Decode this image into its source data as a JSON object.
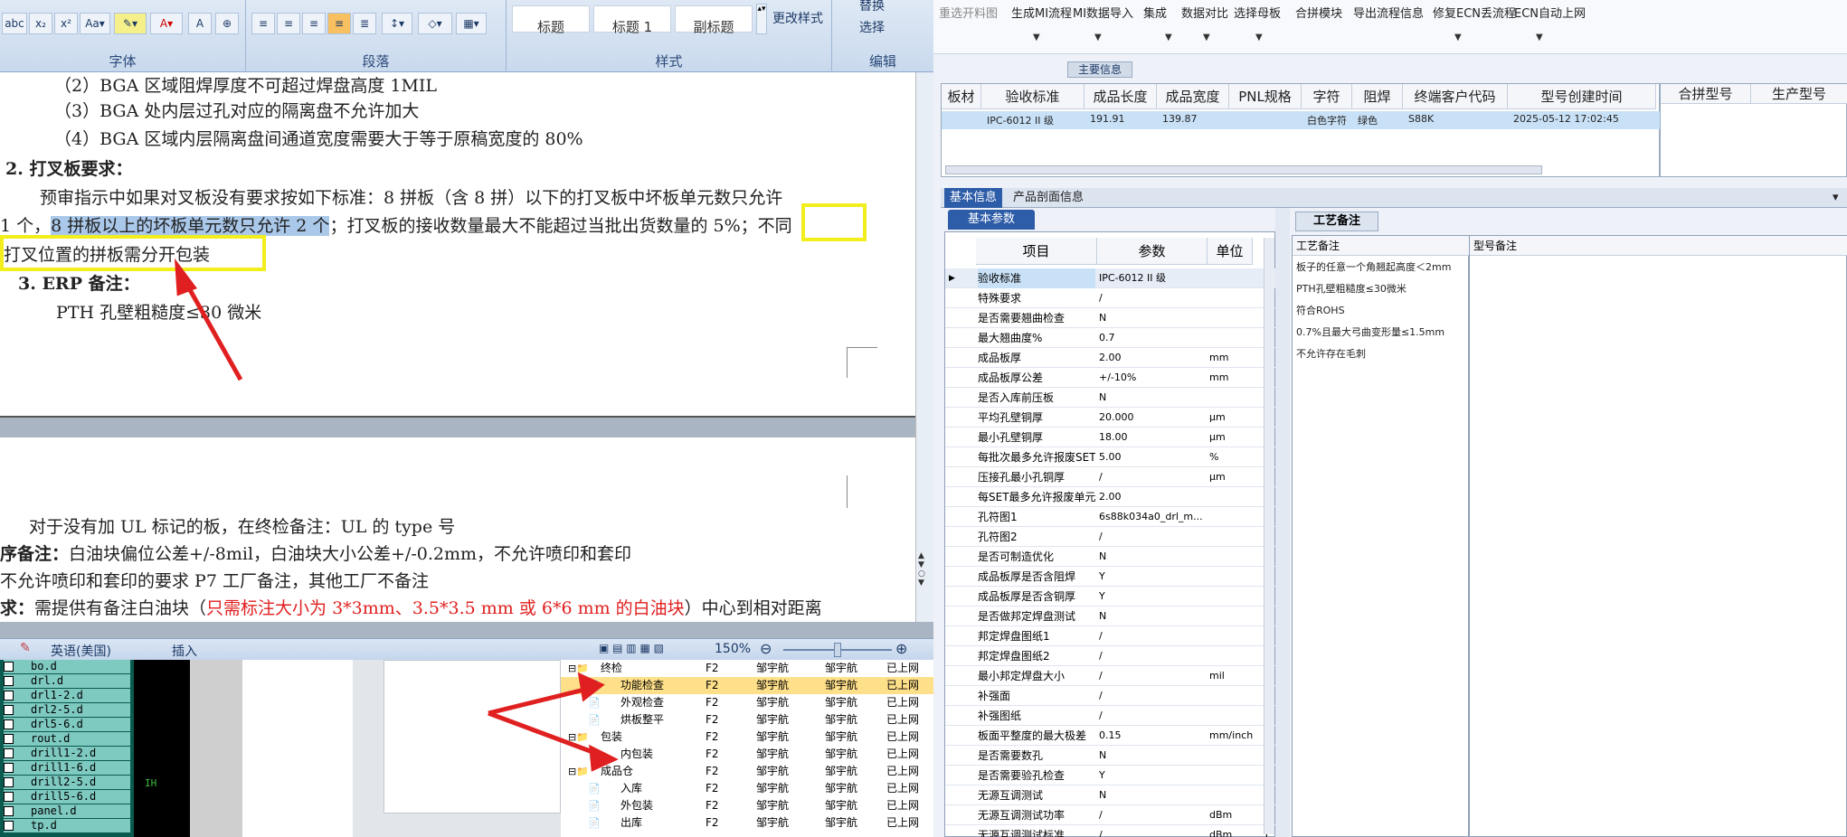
{
  "ribbon": {
    "group_font": "字体",
    "group_paragraph": "段落",
    "group_styles": "样式",
    "group_edit": "编辑",
    "styles": [
      "标题",
      "标题 1",
      "副标题"
    ],
    "change_styles": "更改样式",
    "replace": "替换",
    "select": "选择"
  },
  "doc": {
    "line1": "（2）BGA 区域阻焊厚度不可超过焊盘高度 1MIL",
    "line2": "（3）BGA 处内层过孔对应的隔离盘不允许加大",
    "line3": "（4）BGA 区域内层隔离盘间通道宽度需要大于等于原稿宽度的 80%",
    "line4": "2. 打叉板要求：",
    "line5": "预审指示中如果对叉板没有要求按如下标准：8 拼板（含 8 拼）以下的打叉板中坏板单元数只允许",
    "line6a": "1 个，",
    "line6b": "8 拼板以上的坏板单元数只允许 2 个",
    "line6c": "；打叉板的接收数量最大不能超过当批出货数量的 5%；",
    "line6d": "不同",
    "line7": "打叉位置的拼板需分开包装",
    "line8": "3. ERP 备注：",
    "line9": "PTH 孔壁粗糙度≤30 微米",
    "p2line1": "对于没有加 UL 标记的板，在终检备注：UL 的 type 号",
    "p2line2a": "序备注：",
    "p2line2b": "白油块偏位公差+/-8mil，白油块大小公差+/-0.2mm，不允许喷印和套印",
    "p2line3": "不允许喷印和套印的要求 P7 工厂备注，其他工厂不备注",
    "p2line4a": "求：",
    "p2line4b": "需提供有备注白油块（",
    "p2line4c": "只需标注大小为 3*3mm、3.5*3.5 mm 或 6*6 mm 的白油块",
    "p2line4d": "）中心到相对距离"
  },
  "status": {
    "language": "英语(美国)",
    "insert": "插入",
    "zoom": "150%"
  },
  "files": [
    "bo.d",
    "drl.d",
    "drl1-2.d",
    "drl2-5.d",
    "drl5-6.d",
    "rout.d",
    "drill1-2.d",
    "drill1-6.d",
    "drill2-5.d",
    "drill5-6.d",
    "panel.d",
    "tp.d"
  ],
  "greencon": {
    "label": "IH"
  },
  "tree": [
    {
      "indent": 0,
      "kind": "folder",
      "name": "终检",
      "c1": "F2",
      "c2": "邹宇航",
      "c3": "邹宇航",
      "c4": "已上网",
      "sel": false
    },
    {
      "indent": 1,
      "kind": "doc",
      "name": "功能检查",
      "c1": "F2",
      "c2": "邹宇航",
      "c3": "邹宇航",
      "c4": "已上网",
      "sel": true
    },
    {
      "indent": 1,
      "kind": "doc",
      "name": "外观检查",
      "c1": "F2",
      "c2": "邹宇航",
      "c3": "邹宇航",
      "c4": "已上网",
      "sel": false
    },
    {
      "indent": 1,
      "kind": "doc",
      "name": "烘板整平",
      "c1": "F2",
      "c2": "邹宇航",
      "c3": "邹宇航",
      "c4": "已上网",
      "sel": false
    },
    {
      "indent": 0,
      "kind": "folder",
      "name": "包装",
      "c1": "F2",
      "c2": "邹宇航",
      "c3": "邹宇航",
      "c4": "已上网",
      "sel": false
    },
    {
      "indent": 1,
      "kind": "doc",
      "name": "内包装",
      "c1": "F2",
      "c2": "邹宇航",
      "c3": "邹宇航",
      "c4": "已上网",
      "sel": false
    },
    {
      "indent": 0,
      "kind": "folder",
      "name": "成品仓",
      "c1": "F2",
      "c2": "邹宇航",
      "c3": "邹宇航",
      "c4": "已上网",
      "sel": false
    },
    {
      "indent": 1,
      "kind": "doc",
      "name": "入库",
      "c1": "F2",
      "c2": "邹宇航",
      "c3": "邹宇航",
      "c4": "已上网",
      "sel": false
    },
    {
      "indent": 1,
      "kind": "doc",
      "name": "外包装",
      "c1": "F2",
      "c2": "邹宇航",
      "c3": "邹宇航",
      "c4": "已上网",
      "sel": false
    },
    {
      "indent": 1,
      "kind": "doc",
      "name": "出库",
      "c1": "F2",
      "c2": "邹宇航",
      "c3": "邹宇航",
      "c4": "已上网",
      "sel": false
    }
  ],
  "erp_menu": [
    "重选开料图",
    "生成MI流程",
    "MI数据导入",
    "集成",
    "数据对比",
    "选择母板",
    "合拼模块",
    "导出流程信息",
    "修复ECN丢流程",
    "ECN自动上网"
  ],
  "main_info_tab": "主要信息",
  "top_headers": [
    "板材",
    "验收标准",
    "成品长度",
    "成品宽度",
    "PNL规格",
    "字符",
    "阻焊",
    "终端客户代码",
    "型号创建时间"
  ],
  "top_row": [
    "",
    "IPC-6012 II 级",
    "191.91",
    "139.87",
    "",
    "白色字符",
    "绿色",
    "S88K",
    "2025-05-12 17:02:45"
  ],
  "combo_headers": [
    "合拼型号",
    "生产型号"
  ],
  "tabs2": [
    "基本信息",
    "产品剖面信息"
  ],
  "basic_param_tab": "基本参数",
  "param_headers": [
    "项目",
    "参数",
    "单位"
  ],
  "params": [
    [
      "验收标准",
      "IPC-6012 II 级",
      "",
      "Y"
    ],
    [
      "特殊要求",
      "/",
      "",
      "Y"
    ],
    [
      "是否需要翘曲检查",
      "N",
      "",
      "Y"
    ],
    [
      "最大翘曲度%",
      "0.7",
      "",
      "Y"
    ],
    [
      "成品板厚",
      "2.00",
      "mm",
      "Y"
    ],
    [
      "成品板厚公差",
      "+/-10%",
      "mm",
      "Y"
    ],
    [
      "是否入库前压板",
      "N",
      "",
      "Y"
    ],
    [
      "平均孔壁铜厚",
      "20.000",
      "μm",
      "Y"
    ],
    [
      "最小孔壁铜厚",
      "18.00",
      "μm",
      "Y"
    ],
    [
      "每批次最多允许报废SET",
      "5.00",
      "%",
      "Y"
    ],
    [
      "压接孔最小孔铜厚",
      "/",
      "μm",
      "Y"
    ],
    [
      "每SET最多允许报废单元",
      "2.00",
      "",
      "Y"
    ],
    [
      "孔符图1",
      "6s88k034a0_drl_m...",
      "",
      "Y"
    ],
    [
      "孔符图2",
      "/",
      "",
      "Y"
    ],
    [
      "是否可制造优化",
      "N",
      "",
      "Y"
    ],
    [
      "成品板厚是否含阻焊",
      "Y",
      "",
      "Y"
    ],
    [
      "成品板厚是否含铜厚",
      "Y",
      "",
      "Y"
    ],
    [
      "是否做邦定焊盘测试",
      "N",
      "",
      "Y"
    ],
    [
      "邦定焊盘图纸1",
      "/",
      "",
      "Y"
    ],
    [
      "邦定焊盘图纸2",
      "/",
      "",
      "Y"
    ],
    [
      "最小邦定焊盘大小",
      "/",
      "mil",
      "Y"
    ],
    [
      "补强面",
      "/",
      "",
      "Y"
    ],
    [
      "补强图纸",
      "/",
      "",
      "Y"
    ],
    [
      "板面平整度的最大极差",
      "0.15",
      "mm/inch",
      "Y"
    ],
    [
      "是否需要数孔",
      "N",
      "",
      "Y"
    ],
    [
      "是否需要验孔检查",
      "Y",
      "",
      "Y"
    ],
    [
      "无源互调测试",
      "N",
      "",
      "Y"
    ],
    [
      "无源互调测试功率",
      "/",
      "dBm",
      "Y"
    ],
    [
      "无源互调测试标准",
      "/",
      "dBm",
      "Y"
    ]
  ],
  "proc_tab": "工艺备注",
  "proc_header": "工艺备注",
  "model_header": "型号备注",
  "proc_notes": [
    "板子的任意一个角翘起高度＜2mm",
    "PTH孔壁粗糙度≤30微米",
    "符合ROHS",
    "0.7%且最大弓曲变形量≤1.5mm",
    "不允许存在毛刺"
  ],
  "colors": {
    "highlight_yellow": "#f2ee1c",
    "annotation_red": "#e02020",
    "selection_blue": "#aac8ea"
  }
}
